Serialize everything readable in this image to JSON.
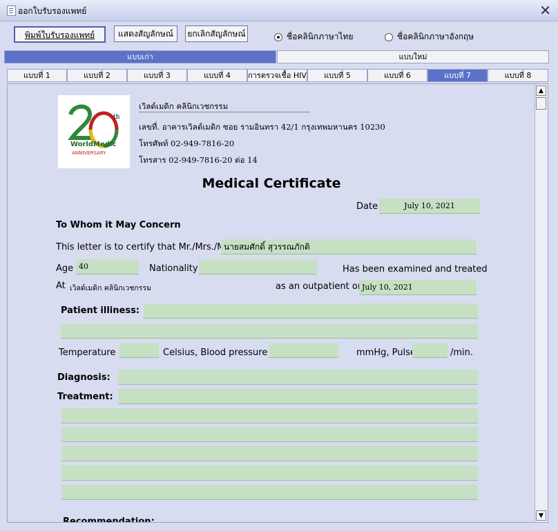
{
  "window": {
    "title": "ออกใบรับรองแพทย์",
    "close": "✕"
  },
  "toolbar": {
    "print_label": "พิมพ์ใบรับรองแพทย์",
    "show_signature_label": "แสดงสัญลักษณ์",
    "cancel_signature_label": "ยกเลิกสัญลักษณ์",
    "radio_thai_label": "ชื่อคลินิกภาษาไทย",
    "radio_english_label": "ชื่อคลินิกภาษาอังกฤษ",
    "radio_selected": "thai"
  },
  "segments": {
    "old": "แบบเก่า",
    "new": "แบบใหม่",
    "selected": "old"
  },
  "tabs": [
    "แบบที่ 1",
    "แบบที่ 2",
    "แบบที่ 3",
    "แบบที่ 4",
    "การตรวจเชื้อ HIV",
    "แบบที่ 5",
    "แบบที่ 6",
    "แบบที่ 7",
    "แบบที่ 8"
  ],
  "selected_tab": "แบบที่ 7",
  "clinic": {
    "logo_text": "WorldMedic ANNIVERSARY 20th",
    "name": "เวิลด์เมดิก คลินิกเวชกรรม",
    "address": "เลขที่. อาคารเวิลด์เมดิก ซอย รามอินทรา 42/1 กรุงเทพมหานคร 10230",
    "phone": "โทรศัพท์ 02-949-7816-20",
    "fax": "โทรสาร 02-949-7816-20 ต่อ 14"
  },
  "certificate": {
    "title": "Medical Certificate",
    "date_label": "Date",
    "date_value": "July 10, 2021",
    "to_whom": "To Whom  it May Concern",
    "certify_label": "This letter is to certify that Mr./Mrs./Miss",
    "patient_name": "นายสมศักดิ์ สุวรรณภักดิ",
    "age_label": "Age",
    "age_value": "40",
    "nationality_label": "Nationality",
    "nationality_value": "",
    "examined_label": "Has been examined and treated",
    "at_label": "At",
    "at_value": "เวิลด์เมดิก คลินิกเวชกรรม",
    "outpatient_label": "as an outpatient on",
    "outpatient_date": "July 10, 2021",
    "illness_label": "Patient illiness:",
    "temperature_label": "Temperature :",
    "celsius_label": "Celsius, Blood pressure :",
    "mmhg_label": "mmHg, Pulse",
    "min_label": "/min.",
    "diagnosis_label": "Diagnosis:",
    "treatment_label": "Treatment:",
    "recommendation_label": "Recommendation:"
  }
}
